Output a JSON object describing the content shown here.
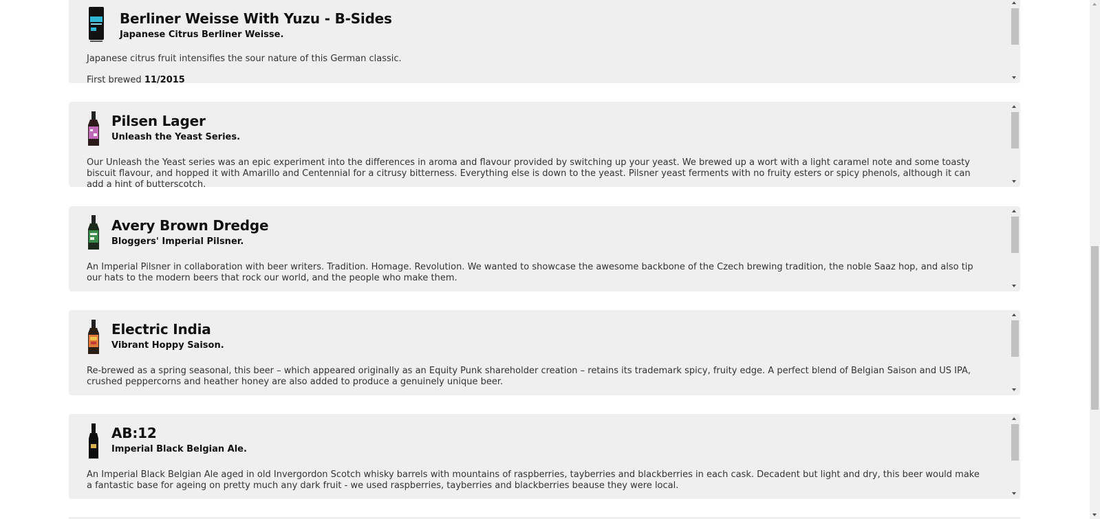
{
  "beers": [
    {
      "name": "Berliner Weisse With Yuzu - B-Sides",
      "tagline": "Japanese Citrus Berliner Weisse.",
      "description": "Japanese citrus fruit intensifies the sour nature of this German classic.",
      "first_brewed_label": "First brewed",
      "first_brewed": "11/2015",
      "image_icon": "beer-can-icon"
    },
    {
      "name": "Pilsen Lager",
      "tagline": "Unleash the Yeast Series.",
      "description": "Our Unleash the Yeast series was an epic experiment into the differences in aroma and flavour provided by switching up your yeast. We brewed up a wort with a light caramel note and some toasty biscuit flavour, and hopped it with Amarillo and Centennial for a citrusy bitterness. Everything else is down to the yeast. Pilsner yeast ferments with no fruity esters or spicy phenols, although it can add a hint of butterscotch.",
      "image_icon": "beer-bottle-icon"
    },
    {
      "name": "Avery Brown Dredge",
      "tagline": "Bloggers' Imperial Pilsner.",
      "description": "An Imperial Pilsner in collaboration with beer writers. Tradition. Homage. Revolution. We wanted to showcase the awesome backbone of the Czech brewing tradition, the noble Saaz hop, and also tip our hats to the modern beers that rock our world, and the people who make them.",
      "image_icon": "beer-bottle-icon"
    },
    {
      "name": "Electric India",
      "tagline": "Vibrant Hoppy Saison.",
      "description": "Re-brewed as a spring seasonal, this beer – which appeared originally as an Equity Punk shareholder creation – retains its trademark spicy, fruity edge. A perfect blend of Belgian Saison and US IPA, crushed peppercorns and heather honey are also added to produce a genuinely unique beer.",
      "image_icon": "beer-bottle-icon"
    },
    {
      "name": "AB:12",
      "tagline": "Imperial Black Belgian Ale.",
      "description": "An Imperial Black Belgian Ale aged in old Invergordon Scotch whisky barrels with mountains of raspberries, tayberries and blackberries in each cask. Decadent but light and dry, this beer would make a fantastic base for ageing on pretty much any dark fruit - we used raspberries, tayberries and blackberries beause they were local.",
      "image_icon": "beer-bottle-icon"
    }
  ],
  "colors": {
    "card_background": "#efefef",
    "scroll_thumb": "#c1c1c1",
    "page_background": "#ffffff"
  }
}
